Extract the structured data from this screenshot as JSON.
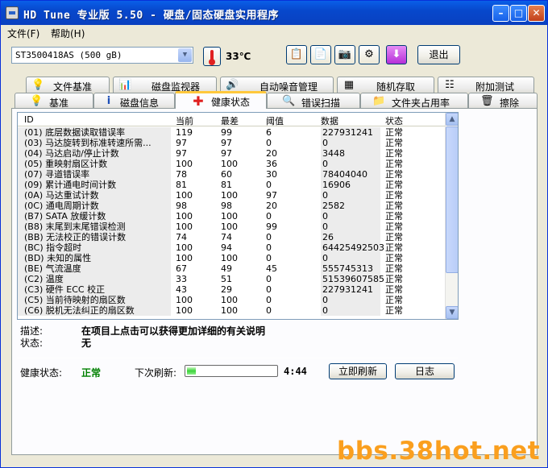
{
  "window": {
    "title": "HD Tune 专业版 5.50 - 硬盘/固态硬盘实用程序",
    "min_icon": "minimize-icon",
    "max_icon": "maximize-icon",
    "close_icon": "close-icon"
  },
  "menu": [
    {
      "label": "文件(F)"
    },
    {
      "label": "帮助(H)"
    }
  ],
  "toolbar": {
    "drive": "ST3500418AS (500 gB)",
    "temperature": "33℃",
    "exit_label": "退出"
  },
  "tabs_top": [
    {
      "label": "文件基准",
      "icon": "file-benchmark-icon"
    },
    {
      "label": "磁盘监视器",
      "icon": "disk-monitor-icon"
    },
    {
      "label": "自动噪音管理",
      "icon": "speaker-icon"
    },
    {
      "label": "随机存取",
      "icon": "random-access-icon"
    },
    {
      "label": "附加测试",
      "icon": "extra-tests-icon"
    }
  ],
  "tabs_bottom": [
    {
      "label": "基准",
      "icon": "benchmark-icon"
    },
    {
      "label": "磁盘信息",
      "icon": "info-icon"
    },
    {
      "label": "健康状态",
      "icon": "health-cross-icon"
    },
    {
      "label": "错误扫描",
      "icon": "error-scan-icon"
    },
    {
      "label": "文件夹占用率",
      "icon": "folder-icon"
    },
    {
      "label": "擦除",
      "icon": "erase-trash-icon"
    }
  ],
  "table": {
    "columns": [
      "ID",
      "当前",
      "最差",
      "阈值",
      "数据",
      "状态"
    ],
    "rows": [
      {
        "id": "(01) 底层数据读取错误率",
        "cur": "119",
        "worst": "99",
        "thr": "6",
        "data": "227931241",
        "status": "正常"
      },
      {
        "id": "(03) 马达旋转到标准转速所需...",
        "cur": "97",
        "worst": "97",
        "thr": "0",
        "data": "0",
        "status": "正常"
      },
      {
        "id": "(04) 马达启动/停止计数",
        "cur": "97",
        "worst": "97",
        "thr": "20",
        "data": "3448",
        "status": "正常"
      },
      {
        "id": "(05) 重映射扇区计数",
        "cur": "100",
        "worst": "100",
        "thr": "36",
        "data": "0",
        "status": "正常"
      },
      {
        "id": "(07) 寻道错误率",
        "cur": "78",
        "worst": "60",
        "thr": "30",
        "data": "78404040",
        "status": "正常"
      },
      {
        "id": "(09) 累计通电时间计数",
        "cur": "81",
        "worst": "81",
        "thr": "0",
        "data": "16906",
        "status": "正常"
      },
      {
        "id": "(0A) 马达重试计数",
        "cur": "100",
        "worst": "100",
        "thr": "97",
        "data": "0",
        "status": "正常"
      },
      {
        "id": "(0C) 通电周期计数",
        "cur": "98",
        "worst": "98",
        "thr": "20",
        "data": "2582",
        "status": "正常"
      },
      {
        "id": "(B7) SATA 放缓计数",
        "cur": "100",
        "worst": "100",
        "thr": "0",
        "data": "0",
        "status": "正常"
      },
      {
        "id": "(B8) 末尾到末尾错误检测",
        "cur": "100",
        "worst": "100",
        "thr": "99",
        "data": "0",
        "status": "正常"
      },
      {
        "id": "(BB) 无法校正的错误计数",
        "cur": "74",
        "worst": "74",
        "thr": "0",
        "data": "26",
        "status": "正常"
      },
      {
        "id": "(BC) 指令超时",
        "cur": "100",
        "worst": "94",
        "thr": "0",
        "data": "64425492503",
        "status": "正常"
      },
      {
        "id": "(BD) 未知的属性",
        "cur": "100",
        "worst": "100",
        "thr": "0",
        "data": "0",
        "status": "正常"
      },
      {
        "id": "(BE) 气流温度",
        "cur": "67",
        "worst": "49",
        "thr": "45",
        "data": "555745313",
        "status": "正常"
      },
      {
        "id": "(C2) 温度",
        "cur": "33",
        "worst": "51",
        "thr": "0",
        "data": "51539607585",
        "status": "正常"
      },
      {
        "id": "(C3) 硬件 ECC 校正",
        "cur": "43",
        "worst": "29",
        "thr": "0",
        "data": "227931241",
        "status": "正常"
      },
      {
        "id": "(C5) 当前待映射的扇区数",
        "cur": "100",
        "worst": "100",
        "thr": "0",
        "data": "0",
        "status": "正常"
      },
      {
        "id": "(C6) 脱机无法纠正的扇区数",
        "cur": "100",
        "worst": "100",
        "thr": "0",
        "data": "0",
        "status": "正常"
      }
    ]
  },
  "description": {
    "desc_label": "描述:",
    "desc_text": "在项目上点击可以获得更加详细的有关说明",
    "status_label": "状态:",
    "status_text": "无"
  },
  "footer": {
    "health_label": "健康状态:",
    "health_value": "正常",
    "health_color": "#008000",
    "next_refresh_label": "下次刷新:",
    "refresh_progress_fraction": 0.1,
    "refresh_time": "4:44",
    "refresh_now_label": "立即刷新",
    "log_label": "日志"
  },
  "watermark": "bbs.38hot.net"
}
